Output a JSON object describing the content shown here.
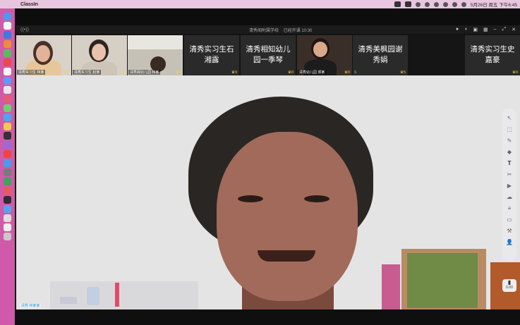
{
  "menubar": {
    "app_name": "ClassIn",
    "datetime": "5月26日 周五 下午6:45"
  },
  "titlebar": {
    "title": "清秀阁附属学校",
    "timer": "已经开课 10:30"
  },
  "participants": [
    {
      "name": "清秀实习生 林某",
      "type": "video",
      "trophy": "0"
    },
    {
      "name": "清秀实习生 赵某",
      "type": "video",
      "trophy": "0"
    },
    {
      "name": "清秀阁幼儿园 林某",
      "type": "video",
      "trophy": "0"
    },
    {
      "name": "清秀实习生石湘露",
      "type": "name",
      "trophy": "0"
    },
    {
      "name": "清秀相知幼儿园一季琴",
      "type": "name",
      "trophy": "0"
    },
    {
      "name": "清秀幼儿园 郭某",
      "type": "video",
      "trophy": "0"
    },
    {
      "name": "清秀美枫园谢秀娟",
      "type": "name",
      "trophy": "5"
    },
    {
      "name": "清秀实习生史嘉豪",
      "type": "name",
      "trophy": "0"
    }
  ],
  "main_video": {
    "self_label": "清秀 林某某"
  },
  "toolbar": {
    "items": [
      "cursor-icon",
      "select-icon",
      "pen-icon",
      "eraser-icon",
      "text-icon",
      "scissors-icon",
      "camera-icon",
      "cloud-icon",
      "layers-icon",
      "folder-icon",
      "tools-icon",
      "users-icon"
    ]
  },
  "stats": {
    "label": "0.00"
  }
}
